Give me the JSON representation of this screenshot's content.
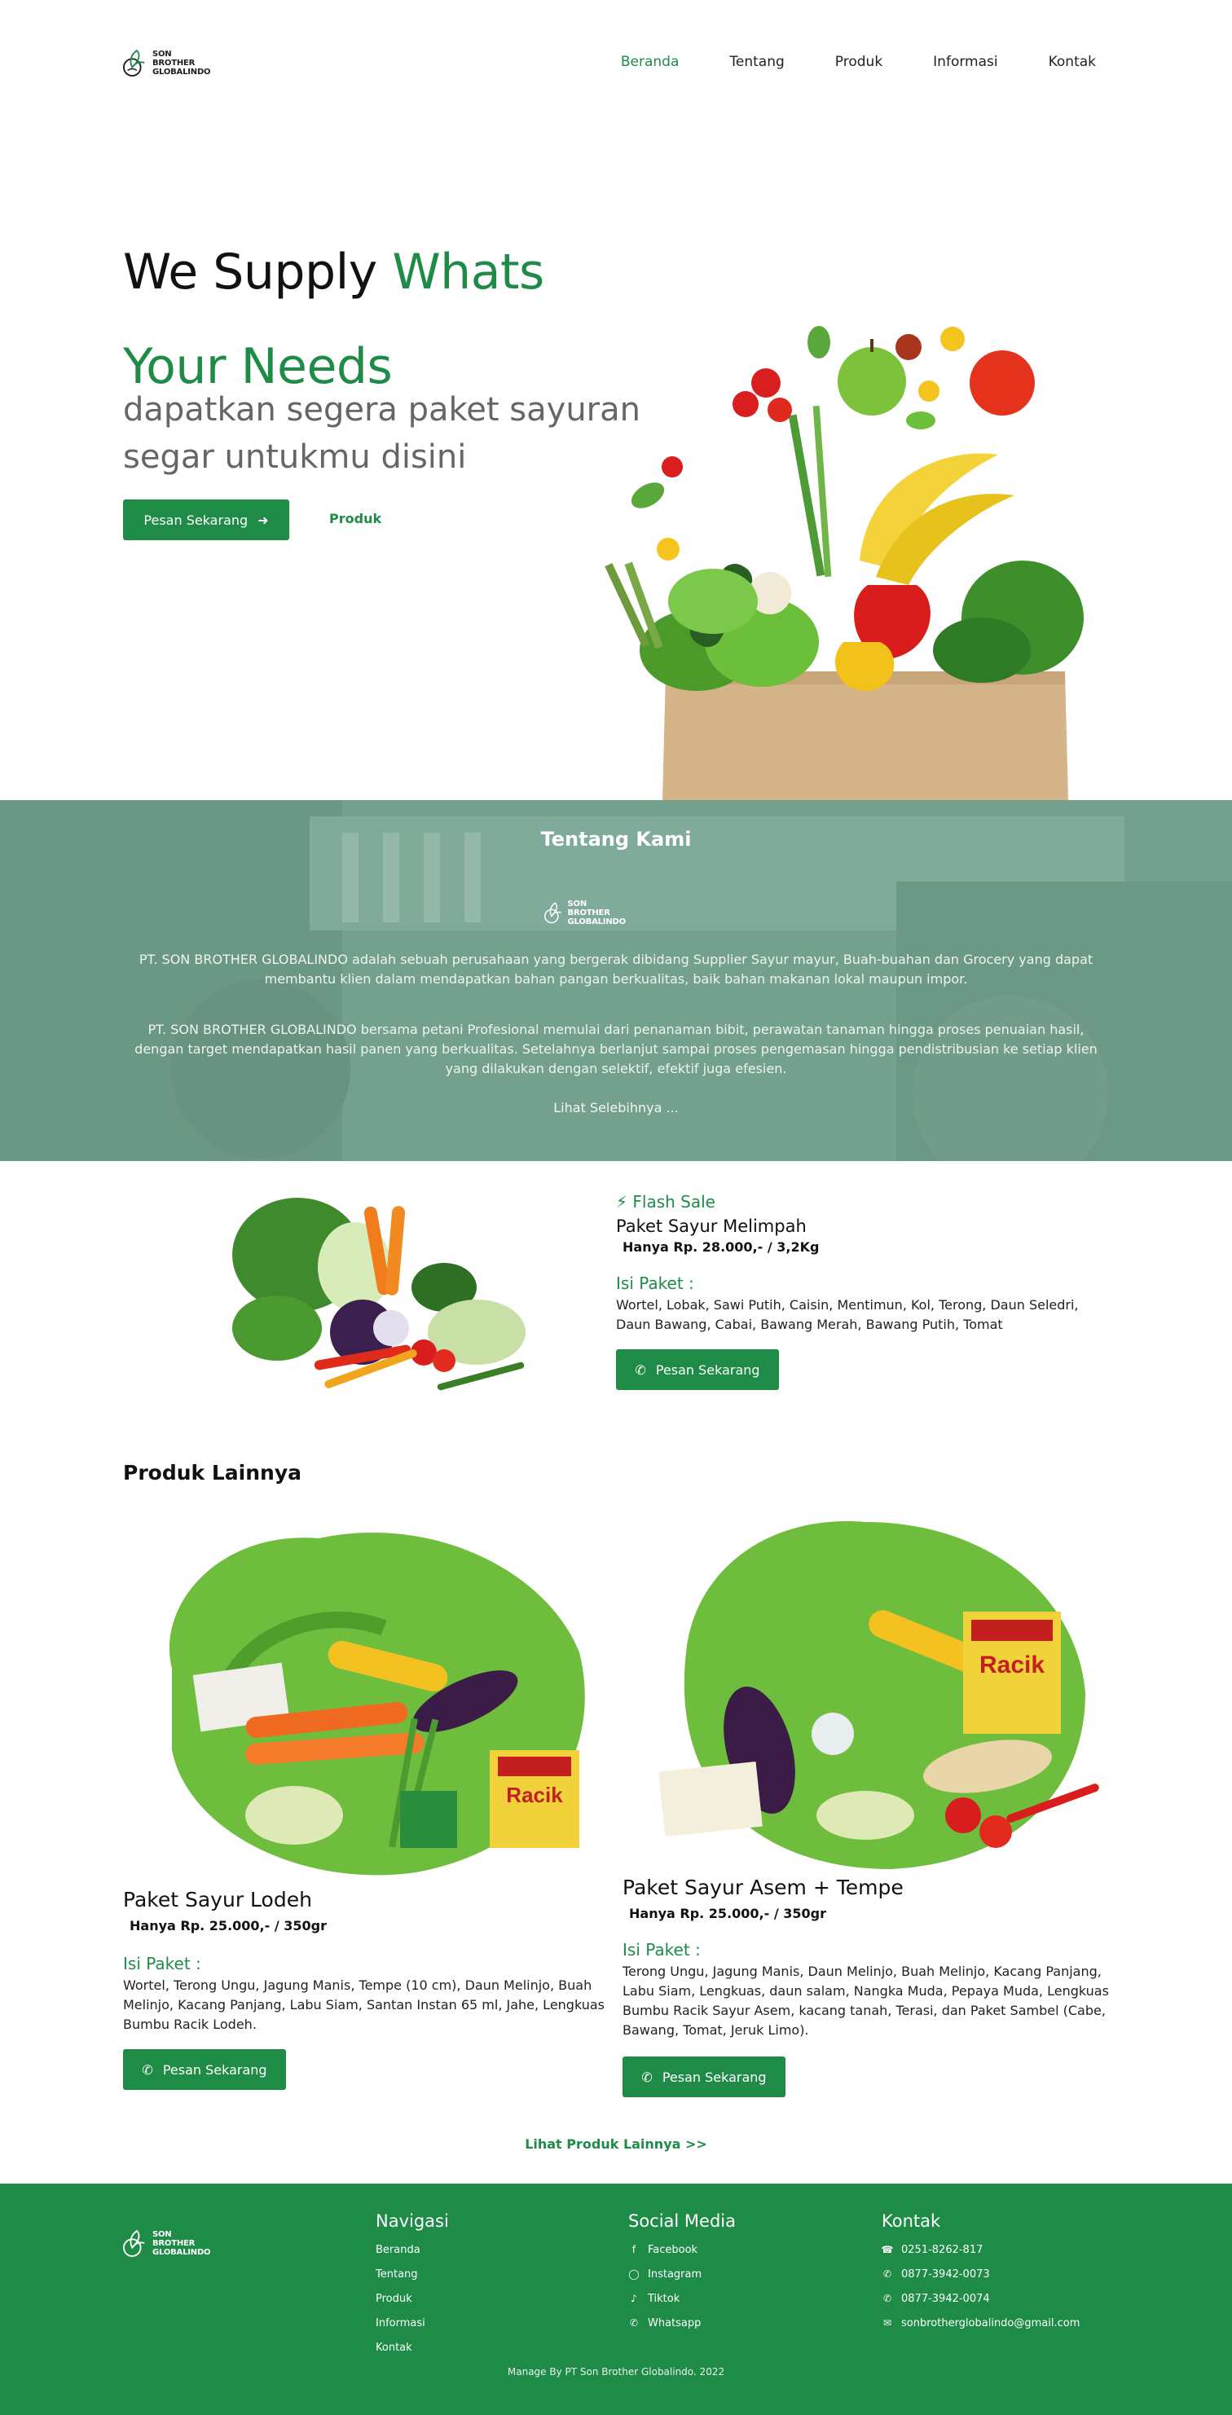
{
  "brand": {
    "name_line1": "SON BROTHER",
    "name_line2": "GLOBALINDO",
    "green": "#1e8b47",
    "about_tint": "#7ba795"
  },
  "nav": {
    "items": [
      "Beranda",
      "Tentang",
      "Produk",
      "Informasi",
      "Kontak"
    ],
    "active": "Beranda"
  },
  "hero": {
    "title_part1": "We Supply ",
    "title_part2": "Whats",
    "title_line2": "Your Needs",
    "subtitle": "dapatkan segera paket sayuran segar untukmu disini",
    "primary_button": "Pesan Sekarang",
    "secondary_link": "Produk"
  },
  "about": {
    "title": "Tentang Kami",
    "paragraph1": "PT. SON BROTHER GLOBALINDO adalah sebuah perusahaan yang bergerak dibidang Supplier Sayur mayur, Buah-buahan dan Grocery yang dapat membantu klien dalam mendapatkan bahan pangan berkualitas, baik bahan makanan lokal maupun impor.",
    "paragraph2": "PT. SON BROTHER GLOBALINDO bersama petani Profesional memulai dari penanaman bibit, perawatan tanaman hingga proses penuaian hasil, dengan target mendapatkan hasil panen yang berkualitas. Setelahnya berlanjut sampai proses pengemasan hingga pendistribusian ke setiap klien yang dilakukan dengan selektif, efektif juga efesien.",
    "more": "Lihat Selebihnya ..."
  },
  "flash_sale": {
    "tag": "Flash Sale",
    "name": "Paket Sayur Melimpah",
    "price": "Hanya Rp. 28.000,- / 3,2Kg",
    "isi_label": "Isi Paket :",
    "contents": "Wortel, Lobak, Sawi Putih, Caisin, Mentimun, Kol, Terong, Daun Seledri, Daun Bawang, Cabai, Bawang Merah, Bawang Putih, Tomat",
    "button": "Pesan Sekarang"
  },
  "products": {
    "title": "Produk Lainnya",
    "items": [
      {
        "name": "Paket Sayur Lodeh",
        "price": "Hanya Rp. 25.000,- / 350gr",
        "isi_label": "Isi Paket :",
        "contents": "Wortel, Terong Ungu, Jagung Manis, Tempe (10 cm), Daun Melinjo, Buah Melinjo, Kacang Panjang, Labu Siam, Santan Instan 65 ml, Jahe, Lengkuas Bumbu Racik Lodeh.",
        "button": "Pesan Sekarang",
        "pack_brand": "Racik"
      },
      {
        "name": "Paket Sayur Asem + Tempe",
        "price": "Hanya Rp. 25.000,- / 350gr",
        "isi_label": "Isi Paket :",
        "contents": "Terong Ungu, Jagung Manis, Daun Melinjo, Buah Melinjo, Kacang Panjang, Labu Siam, Lengkuas, daun salam, Nangka Muda, Pepaya Muda, Lengkuas Bumbu Racik Sayur Asem, kacang tanah, Terasi, dan Paket Sambel (Cabe, Bawang, Tomat, Jeruk Limo).",
        "button": "Pesan Sekarang",
        "pack_brand": "Racik"
      }
    ],
    "more": "Lihat Produk Lainnya >>"
  },
  "footer": {
    "nav_title": "Navigasi",
    "nav_items": [
      "Beranda",
      "Tentang",
      "Produk",
      "Informasi",
      "Kontak"
    ],
    "social_title": "Social Media",
    "social_items": [
      {
        "icon": "facebook-icon",
        "label": "Facebook"
      },
      {
        "icon": "instagram-icon",
        "label": "Instagram"
      },
      {
        "icon": "tiktok-icon",
        "label": "Tiktok"
      },
      {
        "icon": "whatsapp-icon",
        "label": "Whatsapp"
      }
    ],
    "contact_title": "Kontak",
    "contact_items": [
      {
        "icon": "phone-icon",
        "label": "0251-8262-817"
      },
      {
        "icon": "whatsapp-icon",
        "label": "0877-3942-0073"
      },
      {
        "icon": "whatsapp-icon",
        "label": "0877-3942-0074"
      },
      {
        "icon": "envelope-icon",
        "label": "sonbrotherglobalindo@gmail.com"
      }
    ],
    "copyright": "Manage By PT Son Brother Globalindo. 2022"
  }
}
